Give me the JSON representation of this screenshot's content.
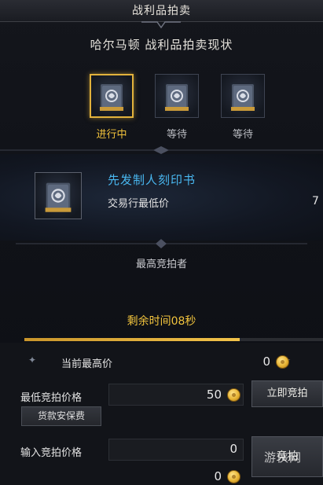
{
  "window": {
    "title": "战利品拍卖"
  },
  "header": {
    "subtitle": "哈尔马顿 战利品拍卖现状"
  },
  "slots": [
    {
      "label": "进行中",
      "state": "active",
      "icon": "book-icon"
    },
    {
      "label": "等待",
      "state": "waiting",
      "icon": "book-icon"
    },
    {
      "label": "等待",
      "state": "waiting",
      "icon": "book-icon"
    }
  ],
  "item": {
    "name": "先发制人刻印书",
    "min_price_label": "交易行最低价",
    "min_price_value": "7",
    "icon": "book-icon"
  },
  "bidder": {
    "label": "最高竞拍者"
  },
  "timer": {
    "label": "剩余时间08秒",
    "progress_fraction": 0.72
  },
  "current_bid": {
    "label": "当前最高价",
    "value": "0",
    "icon": "gold-coin-icon"
  },
  "min_bid": {
    "label": "最低竞拍价格",
    "value": "50",
    "icon": "gold-coin-icon"
  },
  "buyout_button": {
    "label": "立即竞拍"
  },
  "deposit_button": {
    "label": "货款安保费"
  },
  "input_bid": {
    "label": "输入竞拍价格",
    "value": "0"
  },
  "bid_button": {
    "label": "竞拍"
  },
  "deposit_cost": {
    "value": "0",
    "icon": "gold-coin-icon"
  },
  "watermark": {
    "text": "游侠网"
  },
  "colors": {
    "accent_gold": "#f0c13b",
    "item_blue": "#49b7f0"
  }
}
